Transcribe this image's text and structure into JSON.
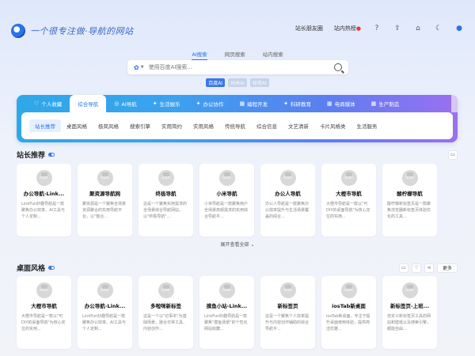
{
  "header": {
    "logo_text": "一个很专注做·导航的网站",
    "links": [
      "站长朋友圈",
      "站内热榜"
    ],
    "icons": [
      "help-icon",
      "share-icon",
      "home-icon",
      "theme-icon",
      "user-icon"
    ]
  },
  "search": {
    "tabs": [
      "AI搜索",
      "网页搜索",
      "站内搜索"
    ],
    "active_tab": "AI搜索",
    "placeholder": "使用百度AI搜索...",
    "ai_engines": [
      "百度AI",
      "纳米AI",
      "秘塔AI"
    ]
  },
  "categories": {
    "tabs": [
      {
        "glyph": "♡",
        "label": "个人收藏"
      },
      {
        "glyph": "",
        "label": "综合导航"
      },
      {
        "glyph": "◎",
        "label": "AI导航"
      },
      {
        "glyph": "✦",
        "label": "生活娱乐"
      },
      {
        "glyph": "✦",
        "label": "办公协作"
      },
      {
        "glyph": "▦",
        "label": "编程开发"
      },
      {
        "glyph": "✦",
        "label": "科研教育"
      },
      {
        "glyph": "▦",
        "label": "电商媒体"
      },
      {
        "glyph": "▦",
        "label": "生产制造"
      }
    ],
    "active_tab": "综合导航",
    "sub_items": [
      "站长推荐",
      "桌面风格",
      "极简风格",
      "搜索引擎",
      "实用简约",
      "实用风格",
      "传统导航",
      "综合信息",
      "文艺清新",
      "卡片风格类",
      "生活服务"
    ],
    "active_sub": "站长推荐"
  },
  "section1": {
    "title": "站长推荐",
    "expand_label": "展开查看全部",
    "cards": [
      {
        "title": "办公导航-Link...",
        "desc": "LinkFun妙趣导航是一款聚焦办公效率、AI工具与个人定制..."
      },
      {
        "title": "聚资源导航网",
        "desc": "聚资源是一个聚焦全场景资源聚合的实用导航平台，以\"整合..."
      },
      {
        "title": "终极导航",
        "desc": "这是一个聚焦实用需求的全场景综合导航网站，以\"终极导航\"..."
      },
      {
        "title": "小米导航",
        "desc": "小米导航是一款聚焦用户全场景高频需求的实用综合导航平..."
      },
      {
        "title": "办公人导航",
        "desc": "办公人导航是一款聚焦办公效率提升与生活场景覆盖的综合..."
      },
      {
        "title": "大橙市导航",
        "desc": "大橙市导航是一款以\"可DIY的桌面导航\"为核心定位的实用..."
      },
      {
        "title": "酸柠檬导航",
        "desc": "酸柠檬新标签页是一款聚焦浏览器新标签页体验优化的工具..."
      }
    ]
  },
  "section2": {
    "title": "桌面风格",
    "more_label": "更多",
    "cards": [
      {
        "title": "大橙市导航",
        "desc": "大橙市导航是一款以\"可DIY的桌面导航\"为核心定位的实用..."
      },
      {
        "title": "办公导航-Link...",
        "desc": "LinkFun妙趣导航是一款聚焦办公效率、AI工具与个人定制..."
      },
      {
        "title": "多啦咪新标签",
        "desc": "这是一个以\"记事本\"为基础场景，融合日常工具、内容创作..."
      },
      {
        "title": "摸鱼小站-Link...",
        "desc": "LinkFun妙趣导航是一款聚焦\"摸鱼场景\"的个性化网站收藏..."
      },
      {
        "title": "新标签页",
        "desc": "这是一个聚焦个人效率提升与内容创作辅助的综合导航平..."
      },
      {
        "title": "iosTab新桌面",
        "desc": "iosTab新桌面，专注于提升桌面使用体验，提供简洁优雅..."
      },
      {
        "title": "新标签页-上班...",
        "desc": "自定义新标签页工具的网站和壁纸以及搜索引擎，都能自由..."
      }
    ]
  }
}
